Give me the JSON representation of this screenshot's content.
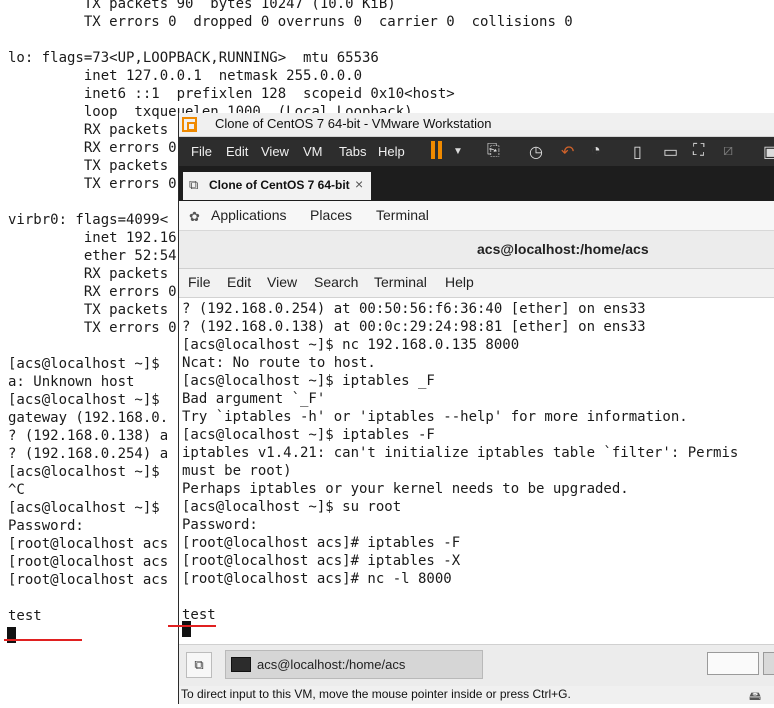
{
  "background_terminal": {
    "lines": [
      "         TX packets 90  bytes 10247 (10.0 KiB)",
      "         TX errors 0  dropped 0 overruns 0  carrier 0  collisions 0",
      "",
      "lo: flags=73<UP,LOOPBACK,RUNNING>  mtu 65536",
      "         inet 127.0.0.1  netmask 255.0.0.0",
      "         inet6 ::1  prefixlen 128  scopeid 0x10<host>",
      "         loop  txqueuelen 1000  (Local Loopback)",
      "         RX packets",
      "         RX errors 0",
      "         TX packets",
      "         TX errors 0",
      "",
      "virbr0: flags=4099<",
      "         inet 192.16",
      "         ether 52:54",
      "         RX packets",
      "         RX errors 0",
      "         TX packets",
      "         TX errors 0",
      "",
      "[acs@localhost ~]$",
      "a: Unknown host",
      "[acs@localhost ~]$",
      "gateway (192.168.0.",
      "? (192.168.0.138) a",
      "? (192.168.0.254) a",
      "[acs@localhost ~]$",
      "^C",
      "[acs@localhost ~]$",
      "Password:",
      "[root@localhost acs",
      "[root@localhost acs",
      "[root@localhost acs",
      "",
      "test"
    ]
  },
  "vm_window": {
    "title": "Clone of CentOS 7 64-bit - VMware Workstation",
    "menu": [
      "File",
      "Edit",
      "View",
      "VM",
      "Tabs",
      "Help"
    ],
    "tab_label": "Clone of CentOS 7 64-bit",
    "tab_close": "×",
    "status_text": "To direct input to this VM, move the mouse pointer inside or press Ctrl+G.",
    "accent_color": "#f08a00"
  },
  "gnome": {
    "applications": "Applications",
    "places": "Places",
    "terminal": "Terminal"
  },
  "terminal": {
    "window_title": "acs@localhost:/home/acs",
    "menu": [
      "File",
      "Edit",
      "View",
      "Search",
      "Terminal",
      "Help"
    ],
    "lines": [
      "? (192.168.0.254) at 00:50:56:f6:36:40 [ether] on ens33",
      "? (192.168.0.138) at 00:0c:29:24:98:81 [ether] on ens33",
      "[acs@localhost ~]$ nc 192.168.0.135 8000",
      "Ncat: No route to host.",
      "[acs@localhost ~]$ iptables _F",
      "Bad argument `_F'",
      "Try `iptables -h' or 'iptables --help' for more information.",
      "[acs@localhost ~]$ iptables -F",
      "iptables v1.4.21: can't initialize iptables table `filter': Permis",
      "must be root)",
      "Perhaps iptables or your kernel needs to be upgraded.",
      "[acs@localhost ~]$ su root",
      "Password:",
      "[root@localhost acs]# iptables -F",
      "[root@localhost acs]# iptables -X",
      "[root@localhost acs]# nc -l 8000",
      "",
      "test"
    ]
  },
  "taskbar": {
    "task_label": "acs@localhost:/home/acs"
  },
  "annotation_color": "#e02020"
}
